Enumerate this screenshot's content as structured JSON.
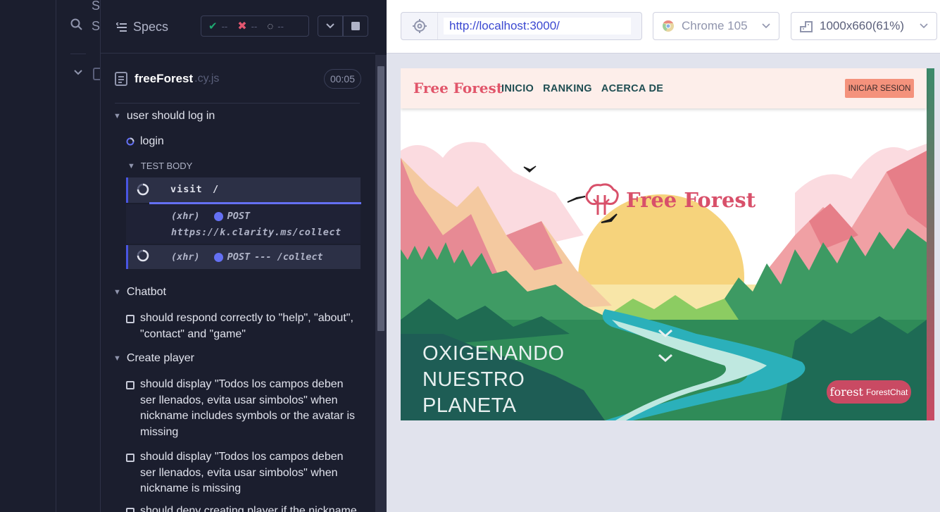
{
  "specs_list": {
    "search_label": "Search",
    "search_label2": "Specs"
  },
  "reporter": {
    "header": {
      "specs_label": "Specs",
      "passed": "--",
      "failed": "--",
      "pending": "--"
    },
    "file": {
      "name": "freeForest",
      "ext": ".cy.js",
      "duration": "00:05"
    },
    "suites": [
      {
        "title": "user should log in",
        "test": "login",
        "body_label": "TEST BODY",
        "commands": [
          {
            "name": "visit",
            "arg": "/"
          }
        ],
        "xhr": [
          {
            "type": "(xhr)",
            "method": "POST",
            "url": "https://k.clarity.ms/collect"
          },
          {
            "type": "(xhr)",
            "method": "POST",
            "url": "--- /collect"
          }
        ]
      },
      {
        "title": "Chatbot",
        "tests": [
          "should respond correctly to \"help\", \"about\", \"contact\" and \"game\""
        ]
      },
      {
        "title": "Create player",
        "tests": [
          "should display \"Todos los campos deben ser llenados, evita usar simbolos\" when nickname includes symbols or the avatar is missing",
          "should display \"Todos los campos deben ser llenados, evita usar simbolos\" when nickname is missing",
          "should deny creating player if the nickname"
        ]
      }
    ]
  },
  "browser_bar": {
    "url": "http://localhost:3000/",
    "browser": "Chrome 105",
    "viewport": "1000x660",
    "scale": "(61%)"
  },
  "site": {
    "brand": "Free Forest",
    "nav": [
      "INICIO",
      "RANKING",
      "ACERCA DE"
    ],
    "login_button": "INICIAR SESION",
    "hero_brand": "Free Forest",
    "hero_lines": [
      "OXIGENANDO",
      "NUESTRO",
      "PLANETA"
    ],
    "chat_brand": "forest",
    "chat_label": "ForestChat"
  },
  "colors": {
    "accent": "#6470f3",
    "pass": "#1fa971",
    "fail": "#e45770",
    "brand": "#e1556a"
  }
}
